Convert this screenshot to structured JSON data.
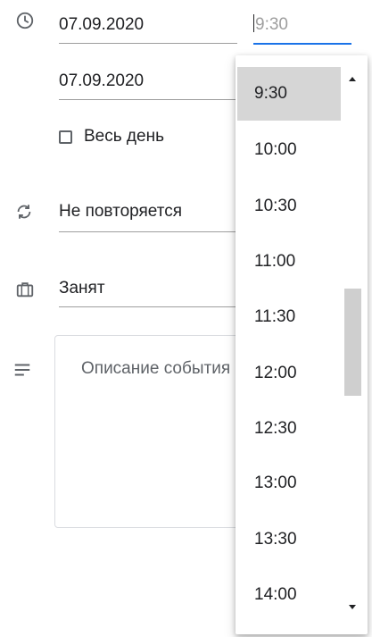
{
  "event": {
    "start_date": "07.09.2020",
    "end_date": "07.09.2020",
    "all_day_label": "Весь день",
    "repeat_label": "Не повторяется",
    "availability_label": "Занят",
    "description_placeholder": "Описание события"
  },
  "time_picker": {
    "input_value": "9:30",
    "selected": "9:30",
    "options": [
      "9:30",
      "10:00",
      "10:30",
      "11:00",
      "11:30",
      "12:00",
      "12:30",
      "13:00",
      "13:30",
      "14:00"
    ]
  },
  "icons": {
    "clock": "clock-icon",
    "repeat": "repeat-icon",
    "briefcase": "briefcase-icon",
    "description": "notes-icon"
  },
  "colors": {
    "accent": "#1a73e8",
    "selected_option": "#d6d6d6",
    "icon": "#5f6368"
  }
}
